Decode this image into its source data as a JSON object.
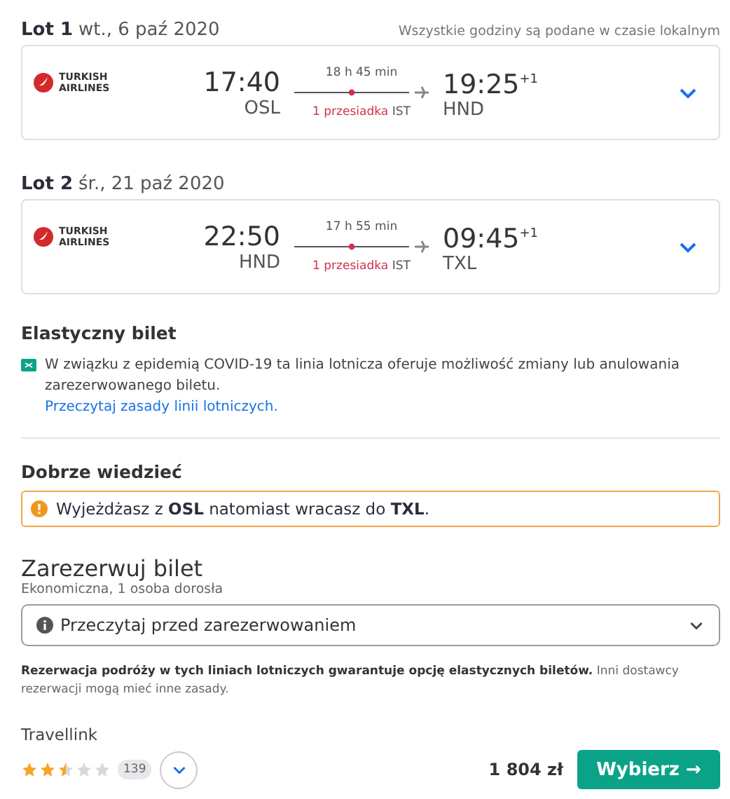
{
  "timezone_note": "Wszystkie godziny są podane w czasie lokalnym",
  "legs": [
    {
      "label": "Lot 1",
      "date": "wt., 6 paź 2020",
      "airline": [
        "TURKISH",
        "AIRLINES"
      ],
      "depart_time": "17:40",
      "depart_airport": "OSL",
      "duration": "18 h 45 min",
      "stops": "1 przesiadka",
      "via": "IST",
      "arrive_time": "19:25",
      "day_offset": "+1",
      "arrive_airport": "HND",
      "expanded": false
    },
    {
      "label": "Lot 2",
      "date": "śr., 21 paź 2020",
      "airline": [
        "TURKISH",
        "AIRLINES"
      ],
      "depart_time": "22:50",
      "depart_airport": "HND",
      "duration": "17 h 55 min",
      "stops": "1 przesiadka",
      "via": "IST",
      "arrive_time": "09:45",
      "day_offset": "+1",
      "arrive_airport": "TXL",
      "expanded": false
    }
  ],
  "flexible": {
    "title": "Elastyczny bilet",
    "text": "W związku z epidemią COVID-19 ta linia lotnicza oferuje możliwość zmiany lub anulowania zarezerwowanego biletu.",
    "link": "Przeczytaj zasady linii lotniczych."
  },
  "good_to_know": {
    "title": "Dobrze wiedzieć",
    "warning": "Wyjeżdżasz z **OSL** natomiast wracasz do **TXL**."
  },
  "booking": {
    "title": "Zarezerwuj bilet",
    "subtitle": "Ekonomiczna, 1 osoba dorosła",
    "dropdown": "Przeczytaj przed zarezerwowaniem",
    "note": "**Rezerwacja podróży w tych liniach lotniczych gwarantuje opcję elastycznych biletów.** Inni dostawcy rezerwacji mogą mieć inne zasady.",
    "provider": {
      "name": "Travellink",
      "stars": 2.5,
      "reviews": "139",
      "price": "1 804 zł",
      "button": "Wybierz →"
    }
  }
}
